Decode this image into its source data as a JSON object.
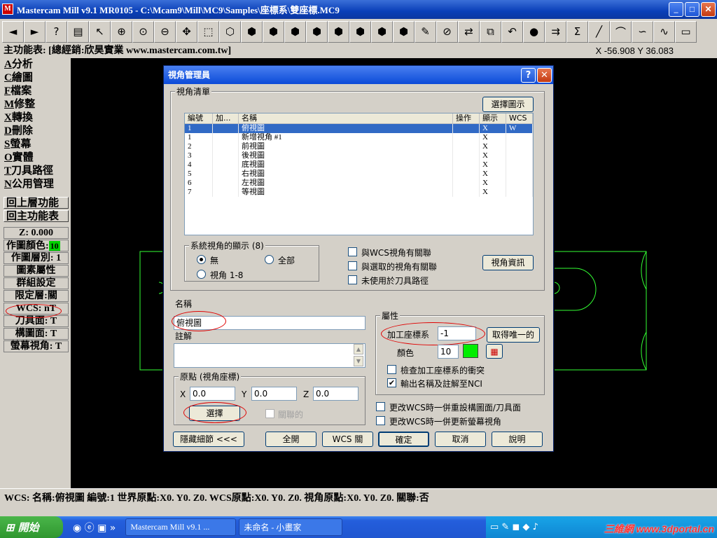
{
  "window": {
    "title": "Mastercam Mill v9.1 MR0105 - C:\\Mcam9\\Mill\\MC9\\Samples\\座標系\\雙座標.MC9",
    "app_icon": "M"
  },
  "window_buttons": {
    "minimize": "_",
    "maximize": "□",
    "close": "✕"
  },
  "toolbar": {
    "icons": [
      "back-arrow",
      "forward-arrow",
      "help",
      "calculator",
      "analyze",
      "zoom-window",
      "zoom-fit",
      "zoom-out",
      "pan",
      "select-chain",
      "solid-select",
      "cube-view-1",
      "cube-view-2",
      "cube-view-3",
      "cube-view-4",
      "cube-view-5",
      "cube-view-6",
      "cube-view-7",
      "cube-view-8",
      "eraser",
      "delete",
      "transform",
      "group",
      "undo",
      "shade-sphere",
      "level",
      "sum",
      "line",
      "arc",
      "curve",
      "spline",
      "rectangle"
    ],
    "glyphs": [
      "◄",
      "►",
      "?",
      "▤",
      "↖",
      "⊕",
      "⊙",
      "⊖",
      "✥",
      "⬚",
      "⬡",
      "⬢",
      "⬢",
      "⬢",
      "⬢",
      "⬢",
      "⬢",
      "⬢",
      "⬢",
      "✎",
      "⊘",
      "⇄",
      "⧉",
      "↶",
      "●",
      "⇉",
      "Σ",
      "╱",
      "⌒",
      "∽",
      "∿",
      "▭"
    ]
  },
  "menubar": {
    "label": "主功能表: [總經銷:欣昊實業 www.mastercam.com.tw]",
    "coords": "X -56.908  Y 36.083"
  },
  "left_menu": [
    {
      "key": "A",
      "label": "分析"
    },
    {
      "key": "C",
      "label": "繪圖"
    },
    {
      "key": "F",
      "label": "檔案"
    },
    {
      "key": "M",
      "label": "修整"
    },
    {
      "key": "X",
      "label": "轉換"
    },
    {
      "key": "D",
      "label": "刪除"
    },
    {
      "key": "S",
      "label": "螢幕"
    },
    {
      "key": "O",
      "label": "實體"
    },
    {
      "key": "T",
      "label": "刀具路徑"
    },
    {
      "key": "N",
      "label": "公用管理"
    }
  ],
  "left_buttons": {
    "back": "回上層功能",
    "main": "回主功能表"
  },
  "left_status": {
    "z": "Z:  0.000",
    "color_label": "作圖顏色:",
    "color_value": "10",
    "level": "作圖層別: 1",
    "attrs": "圖素屬性",
    "group": "群組設定",
    "mask": "限定層:關",
    "wcs": "WCS: nT",
    "tplane": "刀具面: T",
    "cplane": "構圖面: T",
    "gview": "螢幕視角: T"
  },
  "statusbar": {
    "text": "WCS: 名稱:俯視圖   編號:1   世界原點:X0. Y0. Z0.   WCS原點:X0. Y0. Z0.   視角原點:X0. Y0. Z0.   關聯:否"
  },
  "taskbar": {
    "start": "開始",
    "tasks": [
      "Mastercam Mill v9.1 ...",
      "未命名 - 小畫家"
    ],
    "watermark": "三維網 www.3dportal.cn"
  },
  "dialog": {
    "title": "視角管理員",
    "help": "?",
    "close": "✕",
    "list_group": "視角清單",
    "select_plot_btn": "選擇圖示",
    "columns": [
      "編號",
      "加...",
      "名稱",
      "操作",
      "顯示",
      "WCS"
    ],
    "rows": [
      {
        "num": "1",
        "add": "",
        "name": "俯視圖",
        "op": "",
        "show": "X",
        "wcs": "W"
      },
      {
        "num": "1",
        "add": "",
        "name": "新增視角 #1",
        "op": "",
        "show": "X",
        "wcs": ""
      },
      {
        "num": "2",
        "add": "",
        "name": "前視圖",
        "op": "",
        "show": "X",
        "wcs": ""
      },
      {
        "num": "3",
        "add": "",
        "name": "後視圖",
        "op": "",
        "show": "X",
        "wcs": ""
      },
      {
        "num": "4",
        "add": "",
        "name": "底視圖",
        "op": "",
        "show": "X",
        "wcs": ""
      },
      {
        "num": "5",
        "add": "",
        "name": "右視圖",
        "op": "",
        "show": "X",
        "wcs": ""
      },
      {
        "num": "6",
        "add": "",
        "name": "左視圖",
        "op": "",
        "show": "X",
        "wcs": ""
      },
      {
        "num": "7",
        "add": "",
        "name": "等視圖",
        "op": "",
        "show": "X",
        "wcs": ""
      }
    ],
    "sys_group": "系統視角的顯示 (8)",
    "radio_none": "無",
    "radio_all": "全部",
    "radio_18": "視角 1-8",
    "chk_wcs": "與WCS視角有關聯",
    "chk_sel": "與選取的視角有關聯",
    "chk_unused": "未使用於刀具路徑",
    "view_info_btn": "視角資訊",
    "name_label": "名稱",
    "name_value": "俯視圖",
    "comment_label": "註解",
    "origin_group": "原點 (視角座標)",
    "x_label": "X",
    "x_value": "0.0",
    "y_label": "Y",
    "y_value": "0.0",
    "z_label": "Z",
    "z_value": "0.0",
    "select_btn": "選擇",
    "assoc_label": "關聯的",
    "attr_group": "屬性",
    "work_offset_label": "加工座標系",
    "work_offset_value": "-1",
    "get_unique_btn": "取得唯一的",
    "color_label": "顏色",
    "color_value": "10",
    "color_swatch": "#00ee00",
    "chk_check_offset": "檢查加工座標系的衝突",
    "chk_output": "輸出名稱及註解至NCI",
    "chk_reset_cplane": "更改WCS時一併重設構圖面/刀具面",
    "chk_update_gview": "更改WCS時一併更新螢幕視角",
    "btn_hide": "隱藏細節 <<<",
    "btn_all_on": "全開",
    "btn_wcs_off": "WCS 關",
    "btn_ok": "確定",
    "btn_cancel": "取消",
    "btn_help": "說明"
  }
}
